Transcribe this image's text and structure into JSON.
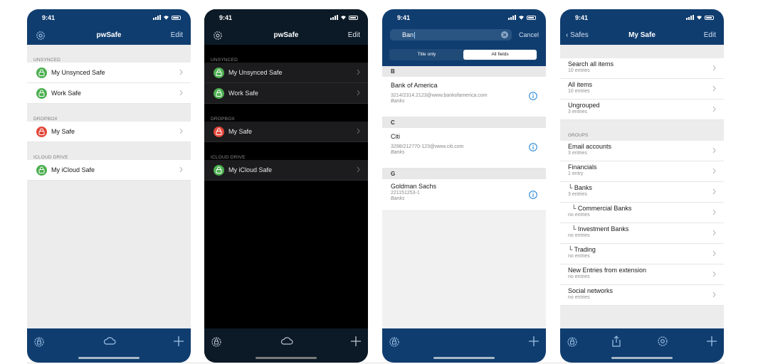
{
  "status_time": "9:41",
  "colors": {
    "navbar": "#103d6f",
    "navbar_dark": "#0c1a27",
    "lock_green": "#4caf50",
    "lock_red": "#e2463a",
    "accent_link": "#1a7fd4"
  },
  "screen1": {
    "title": "pwSafe",
    "edit": "Edit",
    "sections": [
      {
        "header": "UNSYNCED",
        "items": [
          {
            "label": "My Unsynced Safe",
            "lock": "green"
          },
          {
            "label": "Work Safe",
            "lock": "green"
          }
        ]
      },
      {
        "header": "DROPBOX",
        "items": [
          {
            "label": "My Safe",
            "lock": "red"
          }
        ]
      },
      {
        "header": "ICLOUD DRIVE",
        "items": [
          {
            "label": "My iCloud Safe",
            "lock": "green"
          }
        ]
      }
    ],
    "tab_icons": [
      "lock-icon",
      "cloud-icon",
      "plus-icon"
    ]
  },
  "screen2": {
    "title": "pwSafe",
    "edit": "Edit",
    "sections": [
      {
        "header": "UNSYNCED",
        "items": [
          {
            "label": "My Unsynced Safe",
            "lock": "green"
          },
          {
            "label": "Work Safe",
            "lock": "green"
          }
        ]
      },
      {
        "header": "DROPBOX",
        "items": [
          {
            "label": "My Safe",
            "lock": "red"
          }
        ]
      },
      {
        "header": "ICLOUD DRIVE",
        "items": [
          {
            "label": "My iCloud Safe",
            "lock": "green"
          }
        ]
      }
    ]
  },
  "screen3": {
    "search_value": "Ban",
    "cancel": "Cancel",
    "segments": [
      "Title only",
      "All fields"
    ],
    "selected_segment": "All fields",
    "groups": [
      {
        "letter": "B",
        "entries": [
          {
            "title": "Bank of America",
            "user": "3214/2314.2123@www.bankofamerica.com",
            "group": "Banks"
          }
        ]
      },
      {
        "letter": "C",
        "entries": [
          {
            "title": "Citi",
            "user": "3298/212770-123@www.citi.com",
            "group": "Banks"
          }
        ]
      },
      {
        "letter": "G",
        "entries": [
          {
            "title": "Goldman Sachs",
            "user": "221151253-1",
            "group": "Banks"
          }
        ]
      }
    ]
  },
  "screen4": {
    "back": "Safes",
    "title": "My Safe",
    "edit": "Edit",
    "top_items": [
      {
        "name": "Search all items",
        "count": "10 entries"
      },
      {
        "name": "All items",
        "count": "10 entries"
      },
      {
        "name": "Ungrouped",
        "count": "3 entries"
      }
    ],
    "groups_header": "GROUPS",
    "groups": [
      {
        "name": "Email accounts",
        "count": "3 entries"
      },
      {
        "name": "Financials",
        "count": "1 entry"
      },
      {
        "name": "└ Banks",
        "count": "3 entries"
      },
      {
        "name": "└ Commercial Banks",
        "count": "no entries"
      },
      {
        "name": "└ Investment Banks",
        "count": "no entries"
      },
      {
        "name": "└ Trading",
        "count": "no entries"
      },
      {
        "name": "New Entries from extension",
        "count": "no entries"
      },
      {
        "name": "Social networks",
        "count": "no entries"
      }
    ]
  }
}
